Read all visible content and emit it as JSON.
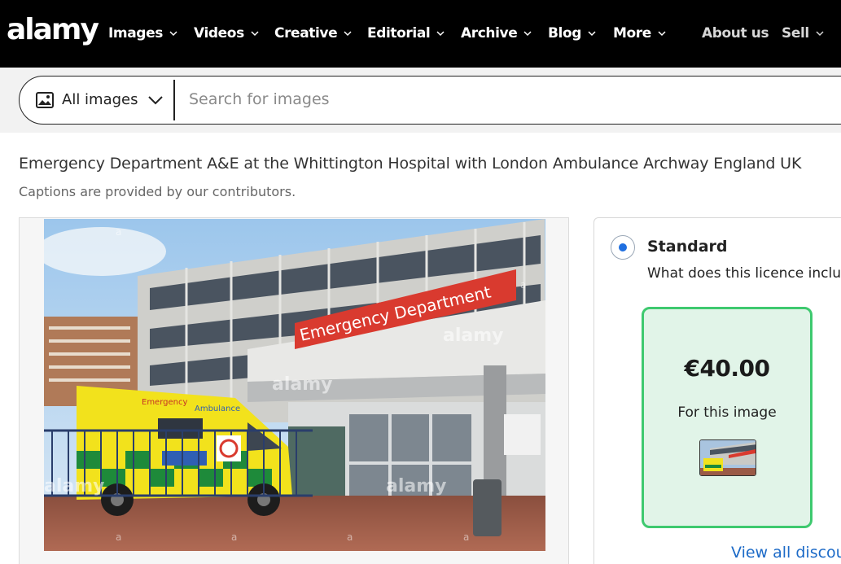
{
  "brand": {
    "logo_text": "alamy",
    "accent": "#3ec96f",
    "link_color": "#1c6ac7"
  },
  "nav": {
    "items": [
      {
        "label": "Images",
        "has_menu": true
      },
      {
        "label": "Videos",
        "has_menu": true
      },
      {
        "label": "Creative",
        "has_menu": true
      },
      {
        "label": "Editorial",
        "has_menu": true
      },
      {
        "label": "Archive",
        "has_menu": true
      },
      {
        "label": "Blog",
        "has_menu": true
      },
      {
        "label": "More",
        "has_menu": true
      }
    ],
    "about_label": "About us",
    "sell_label": "Sell"
  },
  "search": {
    "scope_label": "All images",
    "scope_icon": "image-icon",
    "placeholder": "Search for images"
  },
  "image": {
    "caption": "Emergency Department A&E at the Whittington Hospital with London Ambulance Archway England UK",
    "caption_note": "Captions are provided by our contributors.",
    "sign_text": "Emergency Department",
    "ambulance_text_1": "Emergency",
    "ambulance_text_2": "Ambulance",
    "watermark": "alamy",
    "watermark_mark": "a"
  },
  "licence": {
    "title": "Standard",
    "question": "What does this licence includ",
    "price": "€40.00",
    "price_note": "For this image",
    "view_all_link": "View all discou",
    "selected": true
  }
}
